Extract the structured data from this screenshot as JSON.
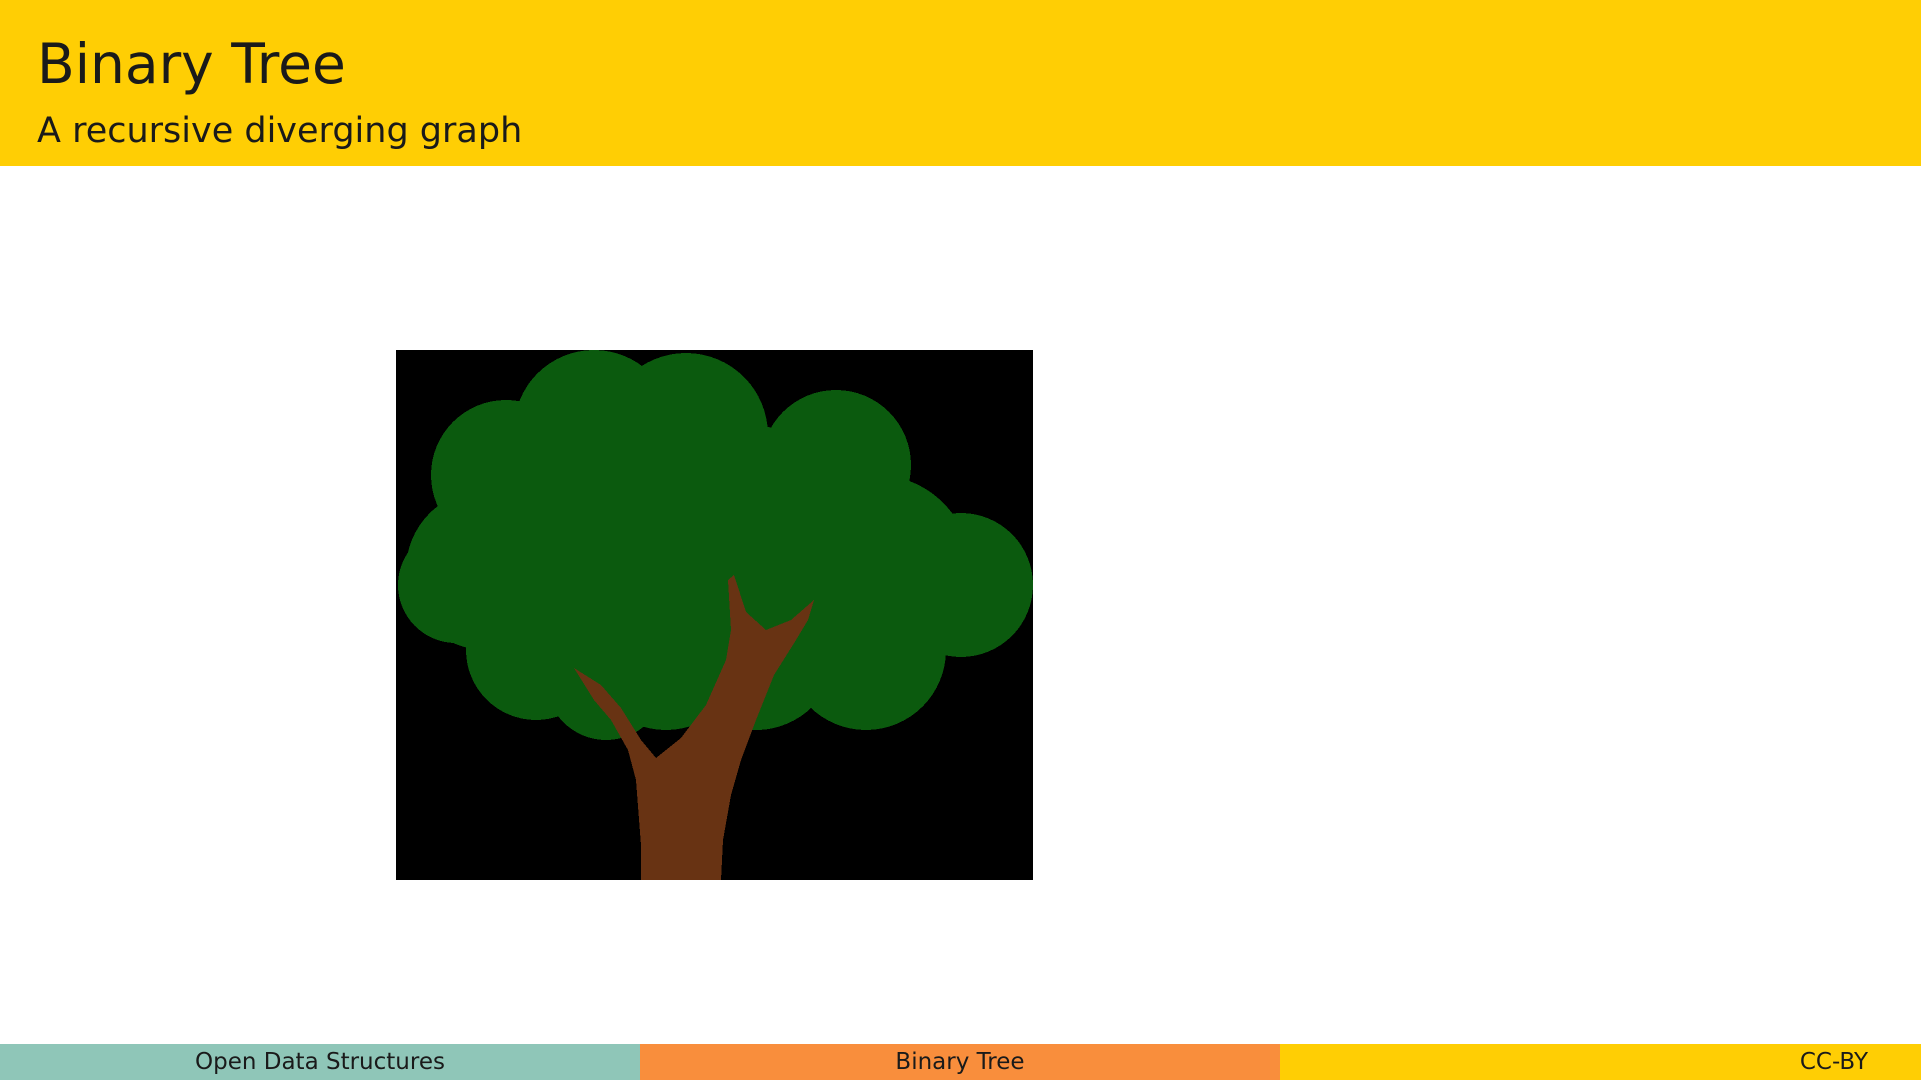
{
  "slide": {
    "title": "Binary Tree",
    "subtitle": "A recursive diverging graph"
  },
  "figure": {
    "icon": "tree-image",
    "colors": {
      "background": "#000000",
      "foliage": "#0B5A0E",
      "trunk": "#683313"
    }
  },
  "footer": {
    "left": "Open Data Structures",
    "center": "Binary Tree",
    "right": "CC-BY"
  },
  "colors": {
    "header": "#FFCE04",
    "footer_left": "#8FC6B8",
    "footer_center": "#F98E3C",
    "footer_right": "#FFCE04"
  }
}
